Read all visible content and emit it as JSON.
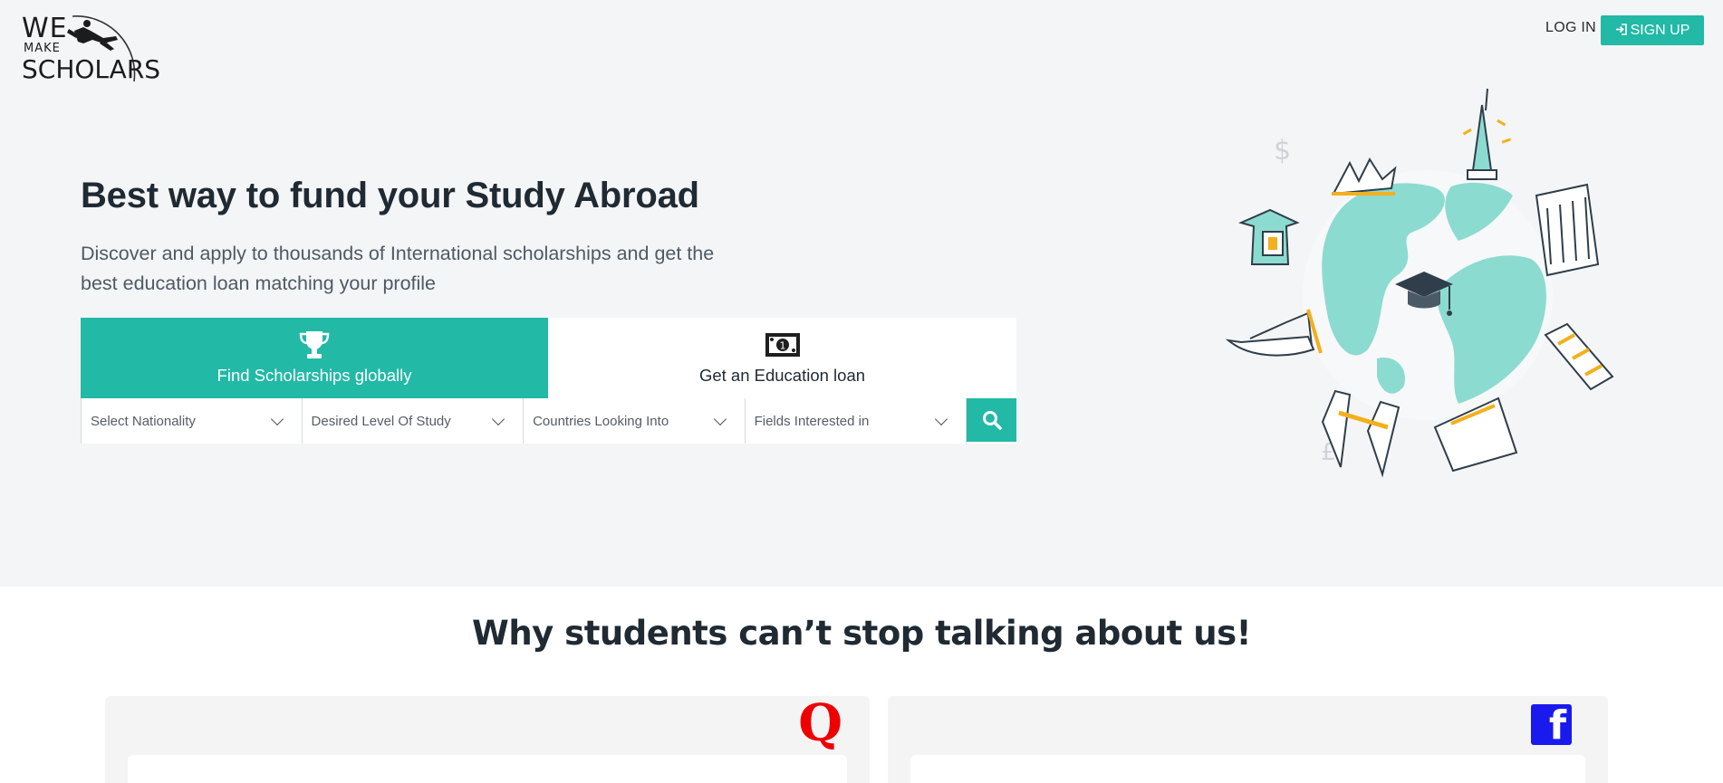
{
  "header": {
    "logo": {
      "line1": "WE",
      "line2": "MAKE",
      "line3": "SCHOLARS"
    },
    "login_label": "LOG IN",
    "signup_label": "SIGN UP"
  },
  "hero": {
    "title": "Best way to fund your Study Abroad",
    "subtitle": "Discover and apply to thousands of International scholarships and get the best education loan matching your profile",
    "tabs": [
      {
        "label": "Find Scholarships globally",
        "icon": "trophy-icon",
        "active": true
      },
      {
        "label": "Get an Education loan",
        "icon": "banknote-icon",
        "active": false
      }
    ],
    "filters": [
      {
        "placeholder": "Select Nationality"
      },
      {
        "placeholder": "Desired Level Of Study"
      },
      {
        "placeholder": "Countries Looking Into"
      },
      {
        "placeholder": "Fields Interested in"
      }
    ],
    "search_icon": "search-icon"
  },
  "testimonials": {
    "heading": "Why students can’t stop talking about us!",
    "cards": [
      {
        "source": "Q",
        "icon": "quora-icon"
      },
      {
        "source": "f",
        "icon": "facebook-icon"
      }
    ]
  },
  "colors": {
    "accent": "#22b9a6",
    "hero_bg": "#f4f5f7",
    "quora": "#ee0000",
    "facebook": "#1a1aee"
  }
}
